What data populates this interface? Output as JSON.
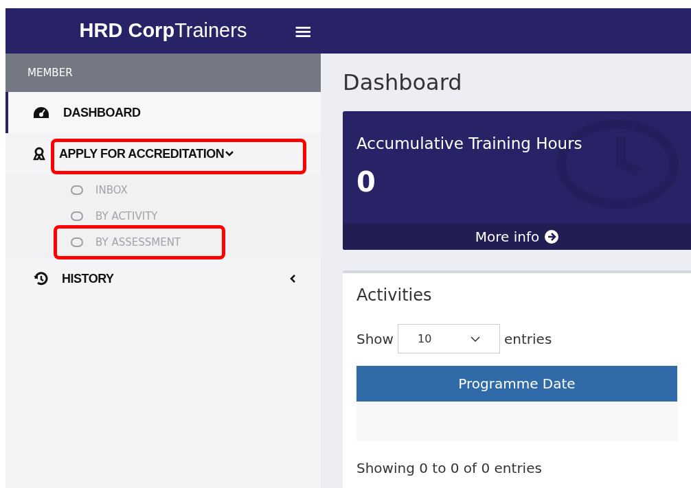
{
  "header": {
    "brand_bold": "HRD Corp",
    "brand_light": "Trainers",
    "menu_icon": "≡"
  },
  "sidebar": {
    "section": "MEMBER",
    "items": [
      {
        "kind": "link",
        "label": "DASHBOARD",
        "selected": true,
        "highlighted": false
      },
      {
        "kind": "group",
        "label": "APPLY FOR ACCREDITATION",
        "selected": false,
        "highlighted": true,
        "expanded": true,
        "children": [
          {
            "label": "INBOX",
            "highlighted": false
          },
          {
            "label": "BY ACTIVITY",
            "highlighted": false
          },
          {
            "label": "BY ASSESSMENT",
            "highlighted": true
          }
        ]
      },
      {
        "kind": "group",
        "label": "HISTORY",
        "selected": false,
        "highlighted": false,
        "expanded": false
      }
    ]
  },
  "page_title": "Dashboard",
  "stat_card": {
    "title": "Accumulative Training Hours",
    "value": "0",
    "link": "More info"
  },
  "activities": {
    "title": "Activities",
    "show_label": "Show",
    "page_size": "10",
    "entries_label": "entries",
    "columns": [
      "Programme Date"
    ],
    "info": "Showing 0 to 0 of 0 entries"
  }
}
